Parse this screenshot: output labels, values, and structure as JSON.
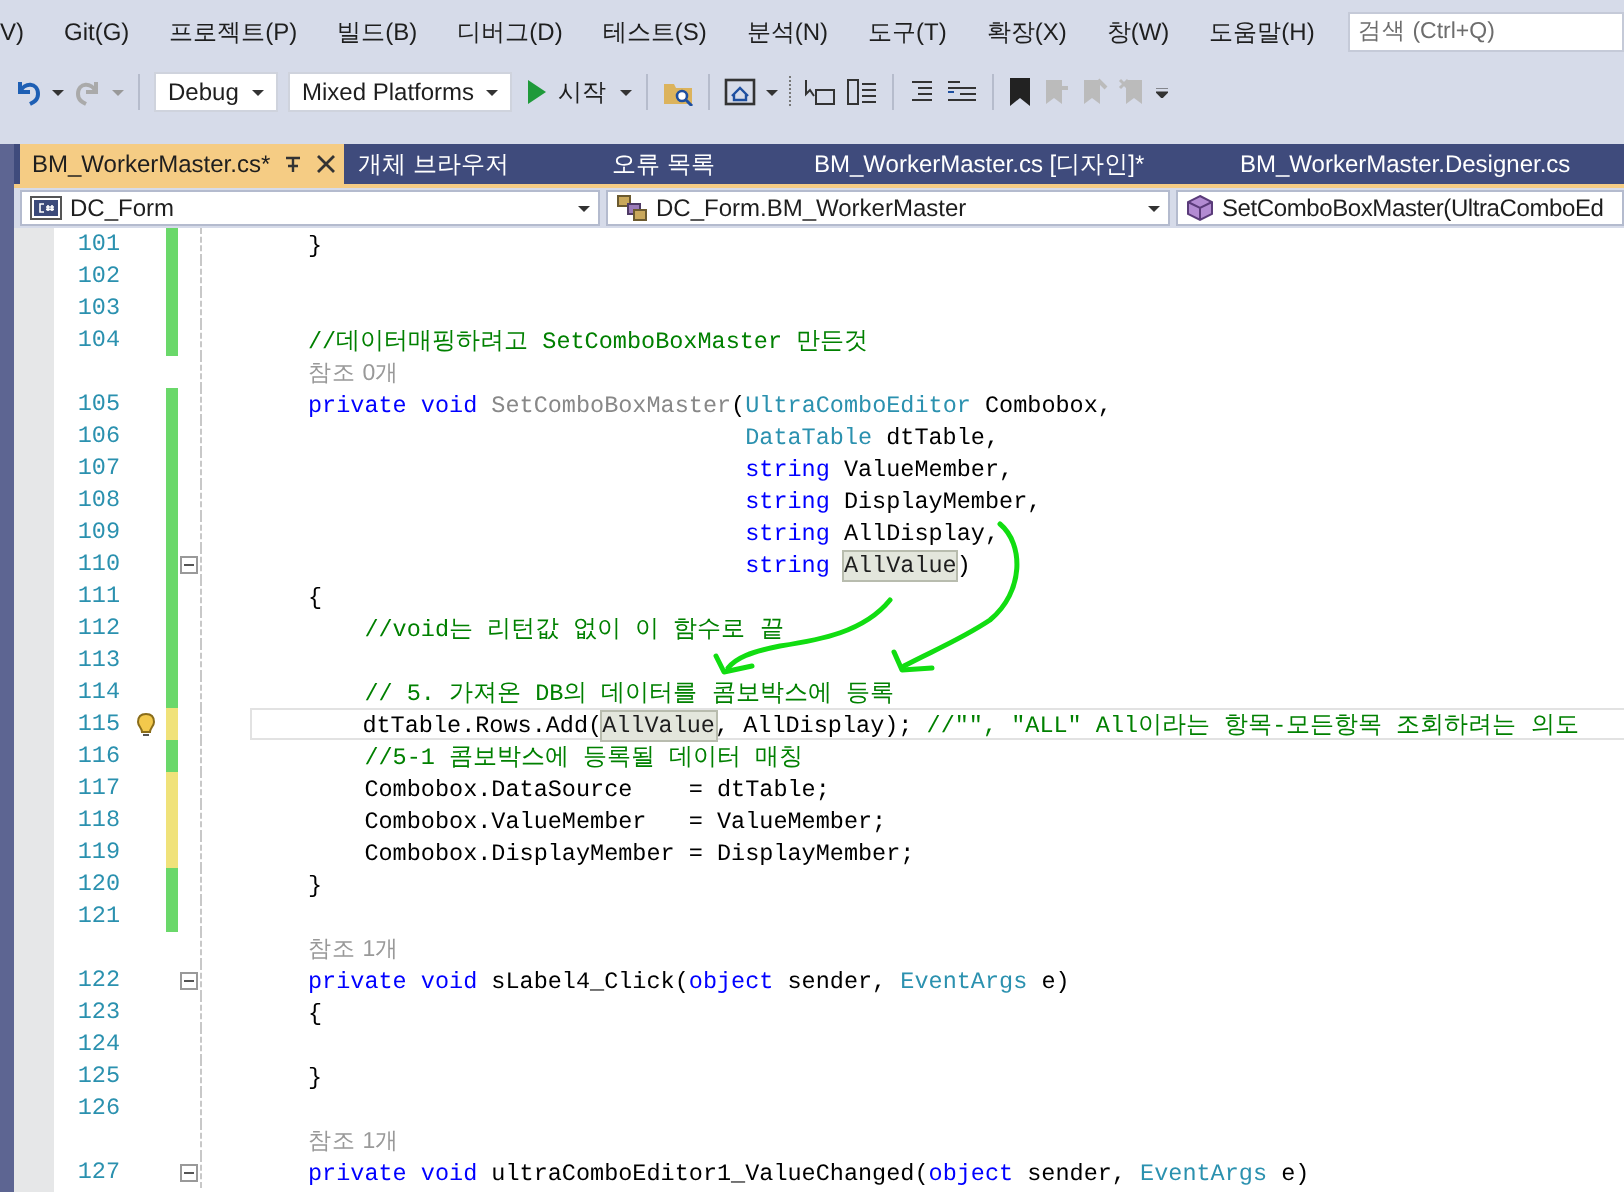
{
  "menu": {
    "items": [
      "V)",
      "Git(G)",
      "프로젝트(P)",
      "빌드(B)",
      "디버그(D)",
      "테스트(S)",
      "분석(N)",
      "도구(T)",
      "확장(X)",
      "창(W)",
      "도움말(H)"
    ],
    "search": {
      "placeholder": "검색 (Ctrl+Q)"
    }
  },
  "toolbar": {
    "configuration": "Debug",
    "platform": "Mixed Platforms",
    "start_label": "시작"
  },
  "tabs": [
    {
      "label": "BM_WorkerMaster.cs*",
      "selected": true
    },
    {
      "label": "개체 브라우저",
      "selected": false
    },
    {
      "label": "오류 목록",
      "selected": false
    },
    {
      "label": "BM_WorkerMaster.cs [디자인]*",
      "selected": false
    },
    {
      "label": "BM_WorkerMaster.Designer.cs",
      "selected": false
    }
  ],
  "navigation_bar": [
    "DC_Form",
    "DC_Form.BM_WorkerMaster",
    "SetComboBoxMaster(UltraComboEd"
  ],
  "code": {
    "lines": [
      {
        "kind": "code",
        "number": "101",
        "color": "#6ad86a",
        "tokens": [
          {
            "kind": "plain",
            "text": "}"
          }
        ]
      },
      {
        "kind": "code",
        "number": "102",
        "color": "#6ad86a"
      },
      {
        "kind": "code",
        "number": "103",
        "color": "#6ad86a"
      },
      {
        "kind": "code",
        "number": "104",
        "color": "#6ad86a",
        "tokens": [
          {
            "kind": "comment",
            "text": "//데이터매핑하려고 SetComboBoxMaster 만든것"
          }
        ]
      },
      {
        "kind": "codelens",
        "text": "참조 0개"
      },
      {
        "kind": "code",
        "number": "105",
        "color": "#6ad86a",
        "tokens": [
          {
            "kind": "keyword",
            "text": "private void "
          },
          {
            "kind": "unused",
            "text": "SetComboBoxMaster"
          },
          {
            "kind": "plain",
            "text": "("
          },
          {
            "kind": "type",
            "text": "UltraComboEditor"
          },
          {
            "kind": "plain",
            "text": " Combobox,"
          }
        ]
      },
      {
        "kind": "code",
        "number": "106",
        "color": "#6ad86a",
        "tokens": [
          {
            "kind": "type",
            "text": "                               DataTable"
          },
          {
            "kind": "plain",
            "text": " dtTable,"
          }
        ]
      },
      {
        "kind": "code",
        "number": "107",
        "color": "#6ad86a",
        "tokens": [
          {
            "kind": "keyword",
            "text": "                               string"
          },
          {
            "kind": "plain",
            "text": " ValueMember,"
          }
        ]
      },
      {
        "kind": "code",
        "number": "108",
        "color": "#6ad86a",
        "tokens": [
          {
            "kind": "keyword",
            "text": "                               string"
          },
          {
            "kind": "plain",
            "text": " DisplayMember,"
          }
        ]
      },
      {
        "kind": "code",
        "number": "109",
        "color": "#6ad86a",
        "tokens": [
          {
            "kind": "keyword",
            "text": "                               string"
          },
          {
            "kind": "plain",
            "text": " AllDisplay,"
          }
        ]
      },
      {
        "kind": "code",
        "number": "110",
        "color": "#6ad86a",
        "fold": true,
        "tokens": [
          {
            "kind": "keyword",
            "text": "                               string "
          },
          {
            "kind": "highlight",
            "text": "AllValue"
          },
          {
            "kind": "plain",
            "text": ")"
          }
        ]
      },
      {
        "kind": "code",
        "number": "111",
        "color": "#6ad86a",
        "tokens": [
          {
            "kind": "plain",
            "text": "{"
          }
        ]
      },
      {
        "kind": "code",
        "number": "112",
        "color": "#6ad86a",
        "tokens": [
          {
            "kind": "comment",
            "text": "    //void는 리턴값 없이 이 함수로 끝"
          }
        ]
      },
      {
        "kind": "code",
        "number": "113",
        "color": "#6ad86a"
      },
      {
        "kind": "code",
        "number": "114",
        "color": "#6ad86a",
        "tokens": [
          {
            "kind": "comment",
            "text": "    // 5. 가져온 DB의 데이터를 콤보박스에 등록"
          }
        ]
      },
      {
        "kind": "code",
        "number": "115",
        "color": "#f0e27a",
        "current": true,
        "lightbulb": true,
        "tokens": [
          {
            "kind": "plain",
            "text": "    dtTable.Rows.Add("
          },
          {
            "kind": "highlight",
            "text": "AllValue"
          },
          {
            "kind": "plain",
            "text": ", AllDisplay); "
          },
          {
            "kind": "comment",
            "text": "//\"\", \"ALL\" All이라는 항목-모든항목 조회하려는 의도"
          }
        ]
      },
      {
        "kind": "code",
        "number": "116",
        "color": "#6ad86a",
        "tokens": [
          {
            "kind": "comment",
            "text": "    //5-1 콤보박스에 등록될 데이터 매칭"
          }
        ]
      },
      {
        "kind": "code",
        "number": "117",
        "color": "#f0e27a",
        "tokens": [
          {
            "kind": "plain",
            "text": "    Combobox.DataSource    = dtTable;"
          }
        ]
      },
      {
        "kind": "code",
        "number": "118",
        "color": "#f0e27a",
        "tokens": [
          {
            "kind": "plain",
            "text": "    Combobox.ValueMember   = ValueMember;"
          }
        ]
      },
      {
        "kind": "code",
        "number": "119",
        "color": "#f0e27a",
        "tokens": [
          {
            "kind": "plain",
            "text": "    Combobox.DisplayMember = DisplayMember;"
          }
        ]
      },
      {
        "kind": "code",
        "number": "120",
        "color": "#6ad86a",
        "tokens": [
          {
            "kind": "plain",
            "text": "}"
          }
        ]
      },
      {
        "kind": "code",
        "number": "121",
        "color": "#6ad86a"
      },
      {
        "kind": "codelens",
        "text": "참조 1개"
      },
      {
        "kind": "code",
        "number": "122",
        "fold": true,
        "tokens": [
          {
            "kind": "keyword",
            "text": "private void "
          },
          {
            "kind": "plain",
            "text": "sLabel4_Click("
          },
          {
            "kind": "keyword",
            "text": "object"
          },
          {
            "kind": "plain",
            "text": " sender, "
          },
          {
            "kind": "type",
            "text": "EventArgs"
          },
          {
            "kind": "plain",
            "text": " e)"
          }
        ]
      },
      {
        "kind": "code",
        "number": "123",
        "tokens": [
          {
            "kind": "plain",
            "text": "{"
          }
        ]
      },
      {
        "kind": "code",
        "number": "124"
      },
      {
        "kind": "code",
        "number": "125",
        "tokens": [
          {
            "kind": "plain",
            "text": "}"
          }
        ]
      },
      {
        "kind": "code",
        "number": "126"
      },
      {
        "kind": "codelens",
        "text": "참조 1개"
      },
      {
        "kind": "code",
        "number": "127",
        "fold": true,
        "tokens": [
          {
            "kind": "keyword",
            "text": "private void "
          },
          {
            "kind": "plain",
            "text": "ultraComboEditor1_ValueChanged("
          },
          {
            "kind": "keyword",
            "text": "object"
          },
          {
            "kind": "plain",
            "text": " sender, "
          },
          {
            "kind": "type",
            "text": "EventArgs"
          },
          {
            "kind": "plain",
            "text": " e)"
          }
        ]
      }
    ]
  }
}
